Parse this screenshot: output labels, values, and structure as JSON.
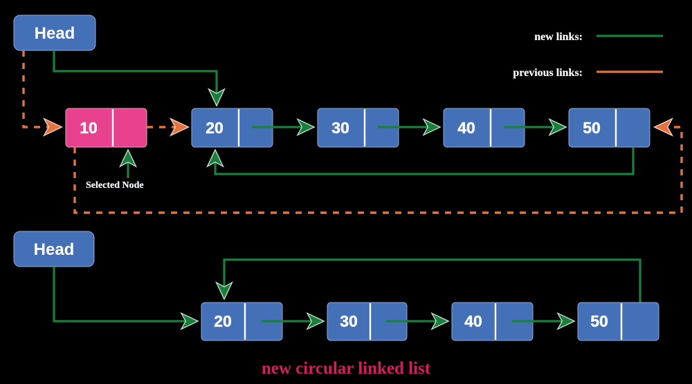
{
  "colors": {
    "background": "#000000",
    "node_blue": "#4470b8",
    "node_blue_stroke": "#3a63a5",
    "node_pink": "#e8428f",
    "node_pink_stroke": "#d6357f",
    "new_link_green": "#1a7f3c",
    "previous_link_orange": "#e2753f",
    "caption_pink": "#d81b60",
    "text_white": "#ffffff",
    "divider_white": "#ffffff"
  },
  "legend": {
    "items": [
      {
        "label": "new links:",
        "color": "#1a7f3c",
        "style": "solid",
        "icon": "green-line-swatch"
      },
      {
        "label": "previous links:",
        "color": "#e2753f",
        "style": "solid",
        "icon": "orange-line-swatch"
      }
    ]
  },
  "diagram_top": {
    "head": {
      "label": "Head"
    },
    "annotation": {
      "label": "Selected Node"
    },
    "nodes": [
      {
        "value": "10",
        "state": "selected",
        "color": "#e8428f"
      },
      {
        "value": "20",
        "state": "normal",
        "color": "#4470b8"
      },
      {
        "value": "30",
        "state": "normal",
        "color": "#4470b8"
      },
      {
        "value": "40",
        "state": "normal",
        "color": "#4470b8"
      },
      {
        "value": "50",
        "state": "normal",
        "color": "#4470b8"
      }
    ]
  },
  "diagram_bottom": {
    "head": {
      "label": "Head"
    },
    "caption": "new circular linked list",
    "nodes": [
      {
        "value": "20",
        "state": "normal",
        "color": "#4470b8"
      },
      {
        "value": "30",
        "state": "normal",
        "color": "#4470b8"
      },
      {
        "value": "40",
        "state": "normal",
        "color": "#4470b8"
      },
      {
        "value": "50",
        "state": "normal",
        "color": "#4470b8"
      }
    ]
  }
}
